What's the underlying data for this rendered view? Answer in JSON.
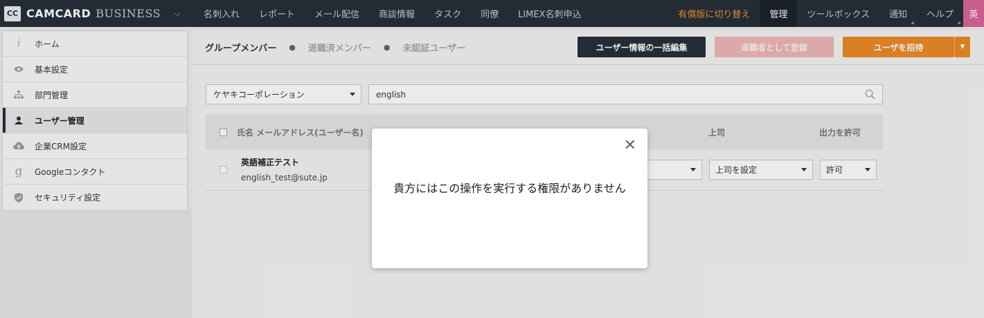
{
  "brand": {
    "badge": "CC",
    "name": "CAMCARD",
    "suffix": "BUSINESS"
  },
  "nav": {
    "items": [
      "名刺入れ",
      "レポート",
      "メール配信",
      "商談情報",
      "タスク",
      "同僚",
      "LIMEX名刺申込"
    ],
    "upgrade": "有償版に切り替え",
    "admin": "管理",
    "toolbox": "ツールボックス",
    "notify": "通知",
    "help": "ヘルプ",
    "lang": "英"
  },
  "sidebar": {
    "items": [
      {
        "label": "ホーム",
        "icon": "info-icon"
      },
      {
        "label": "基本設定",
        "icon": "eye-icon"
      },
      {
        "label": "部門管理",
        "icon": "org-chart-icon"
      },
      {
        "label": "ユーザー管理",
        "icon": "user-icon"
      },
      {
        "label": "企業CRM設定",
        "icon": "cloud-upload-icon"
      },
      {
        "label": "Googleコンタクト",
        "icon": "google-icon"
      },
      {
        "label": "セキュリティ設定",
        "icon": "shield-icon"
      }
    ],
    "active_index": 3
  },
  "tabs": {
    "members": "グループメンバー",
    "retired": "退職済メンバー",
    "unverified": "未認証ユーザー"
  },
  "buttons": {
    "bulk_edit": "ユーザー情報の一括編集",
    "register_retired": "退職者として登録",
    "invite": "ユーザを招待"
  },
  "filters": {
    "company": "ケヤキコーポレーション",
    "search_value": "english"
  },
  "table": {
    "headers": {
      "name": "氏名 メールアドレス(ユーザー名)",
      "boss": "上司",
      "export": "出力を許可"
    },
    "rows": [
      {
        "name": "英語補正テスト",
        "email": "english_test@sute.jp",
        "boss": "上司を設定",
        "export": "許可"
      }
    ]
  },
  "modal": {
    "message": "貴方にはこの操作を実行する権限がありません"
  },
  "colors": {
    "nav_bg": "#27303a",
    "accent_orange": "#ed8a26",
    "disabled_pink": "#f0b7b7",
    "lang_pink": "#d9669a"
  }
}
